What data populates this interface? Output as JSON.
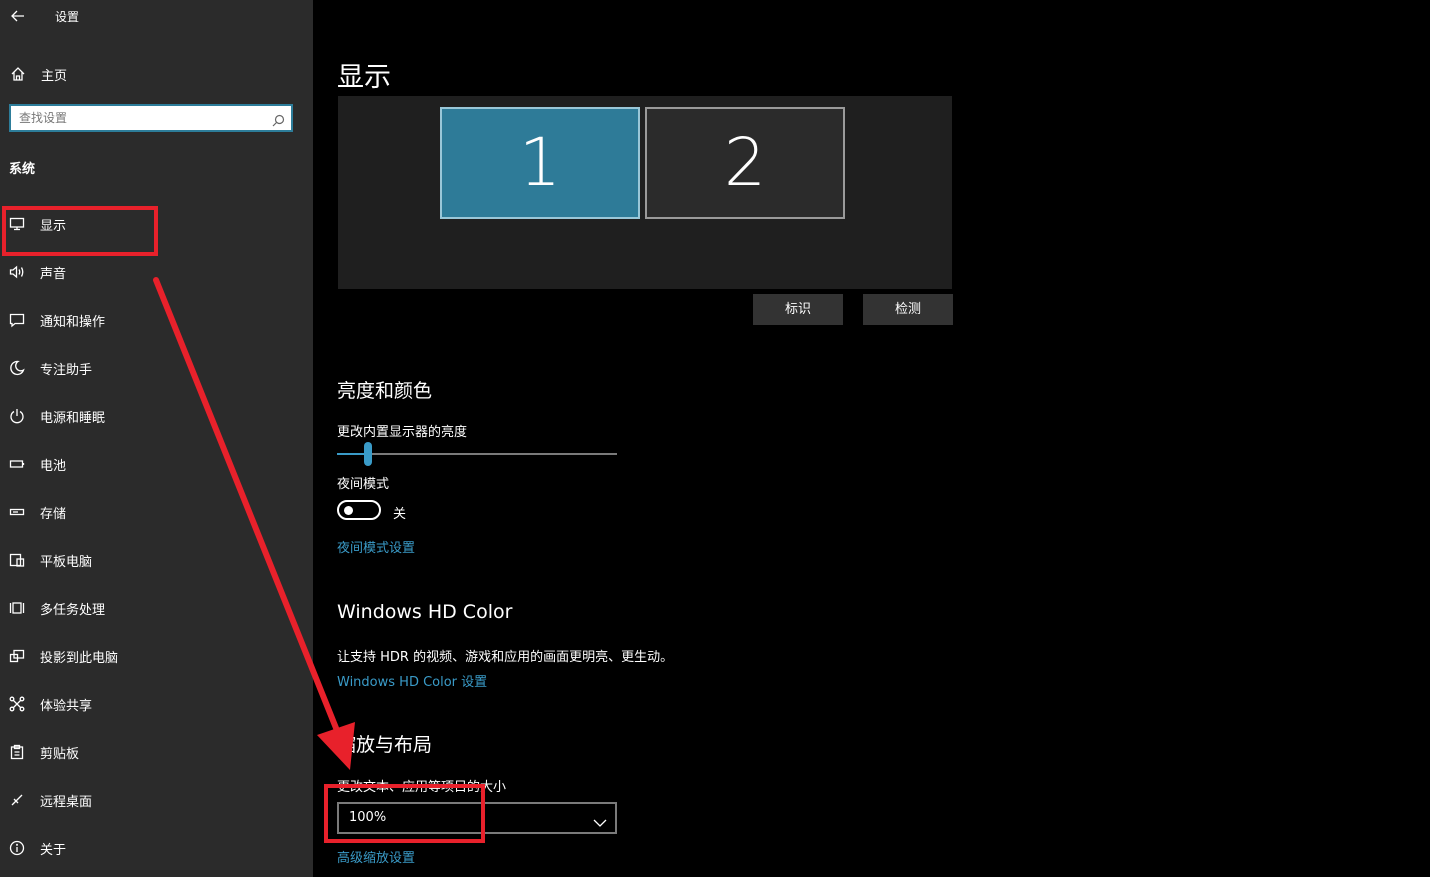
{
  "window": {
    "title": "设置"
  },
  "sidebar": {
    "home_label": "主页",
    "search": {
      "placeholder": "查找设置",
      "value": ""
    },
    "section": "系统",
    "items": [
      {
        "label": "显示",
        "icon": "monitor-icon"
      },
      {
        "label": "声音",
        "icon": "speaker-icon"
      },
      {
        "label": "通知和操作",
        "icon": "message-icon"
      },
      {
        "label": "专注助手",
        "icon": "moon-icon"
      },
      {
        "label": "电源和睡眠",
        "icon": "power-icon"
      },
      {
        "label": "电池",
        "icon": "battery-icon"
      },
      {
        "label": "存储",
        "icon": "storage-icon"
      },
      {
        "label": "平板电脑",
        "icon": "tablet-icon"
      },
      {
        "label": "多任务处理",
        "icon": "multitask-icon"
      },
      {
        "label": "投影到此电脑",
        "icon": "project-icon"
      },
      {
        "label": "体验共享",
        "icon": "share-icon"
      },
      {
        "label": "剪贴板",
        "icon": "clipboard-icon"
      },
      {
        "label": "远程桌面",
        "icon": "remote-icon"
      },
      {
        "label": "关于",
        "icon": "info-icon"
      }
    ]
  },
  "main": {
    "title": "显示",
    "monitors": [
      "1",
      "2"
    ],
    "identify_label": "标识",
    "detect_label": "检测",
    "brightness": {
      "heading": "亮度和颜色",
      "slider_label": "更改内置显示器的亮度",
      "value_fraction": 0.11,
      "night_label": "夜间模式",
      "night_state": "关",
      "night_link": "夜间模式设置"
    },
    "hdr": {
      "heading": "Windows HD Color",
      "desc": "让支持 HDR 的视频、游戏和应用的画面更明亮、更生动。",
      "link": "Windows HD Color 设置"
    },
    "scale": {
      "heading": "缩放与布局",
      "label": "更改文本、应用等项目的大小",
      "value": "100%",
      "link": "高级缩放设置"
    }
  },
  "colors": {
    "accent": "#2e7b98",
    "link": "#3a9bc8",
    "annotation": "#e8212b"
  }
}
